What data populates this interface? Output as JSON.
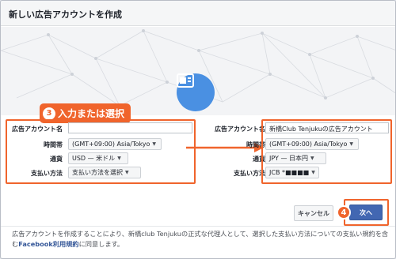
{
  "dialog": {
    "title": "新しい広告アカウントを作成"
  },
  "colors": {
    "accent": "#4267b2",
    "annotation": "#f0642c",
    "hero_icon": "#4a90e2"
  },
  "hero": {
    "icon": "ad-account-icon"
  },
  "annotation": {
    "step3_number": "3",
    "step3_text": "入力または選択",
    "step4_number": "4"
  },
  "form_left": {
    "name_label": "広告アカウント名",
    "name_value": "",
    "timezone_label": "時間帯",
    "timezone_value": "(GMT+09:00) Asia/Tokyo",
    "currency_label": "通貨",
    "currency_value": "USD — 米ドル",
    "payment_label": "支払い方法",
    "payment_value": "支払い方法を選択"
  },
  "form_right": {
    "name_label": "広告アカウント名",
    "name_value": "新橋Club Tenjukuの広告アカウント",
    "timezone_label": "時間帯",
    "timezone_value": "(GMT+09:00) Asia/Tokyo",
    "currency_label": "通貨",
    "currency_value": "JPY — 日本円",
    "payment_label": "支払い方法",
    "payment_value": "JCB *■■■■"
  },
  "footer": {
    "cancel_label": "キャンセル",
    "next_label": "次へ",
    "legal_before": "広告アカウントを作成することにより、新橋club Tenjukuの正式な代理人として、選択した支払い方法についての支払い規約を含む",
    "legal_link": "Facebook利用規約",
    "legal_after": "に同意します。"
  }
}
